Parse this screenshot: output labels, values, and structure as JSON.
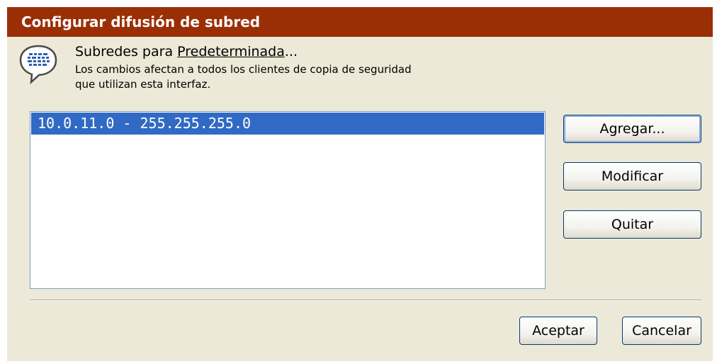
{
  "window": {
    "title": "Configurar difusión de subred"
  },
  "header": {
    "icon": "speech-bubble-network-icon",
    "heading_prefix": "Subredes para ",
    "heading_link": "Predeterminada",
    "heading_suffix": "...",
    "description_line1": "Los cambios afectan a todos los clientes de copia de seguridad",
    "description_line2": "que utilizan esta interfaz."
  },
  "subnets": {
    "items": [
      {
        "label": "10.0.11.0 - 255.255.255.0",
        "selected": true
      }
    ]
  },
  "buttons": {
    "add": "Agregar...",
    "modify": "Modificar",
    "remove": "Quitar",
    "ok": "Aceptar",
    "cancel": "Cancelar"
  },
  "colors": {
    "title_bar": "#9a2f06",
    "dialog_background": "#ece9d8",
    "selection": "#316ac5"
  }
}
